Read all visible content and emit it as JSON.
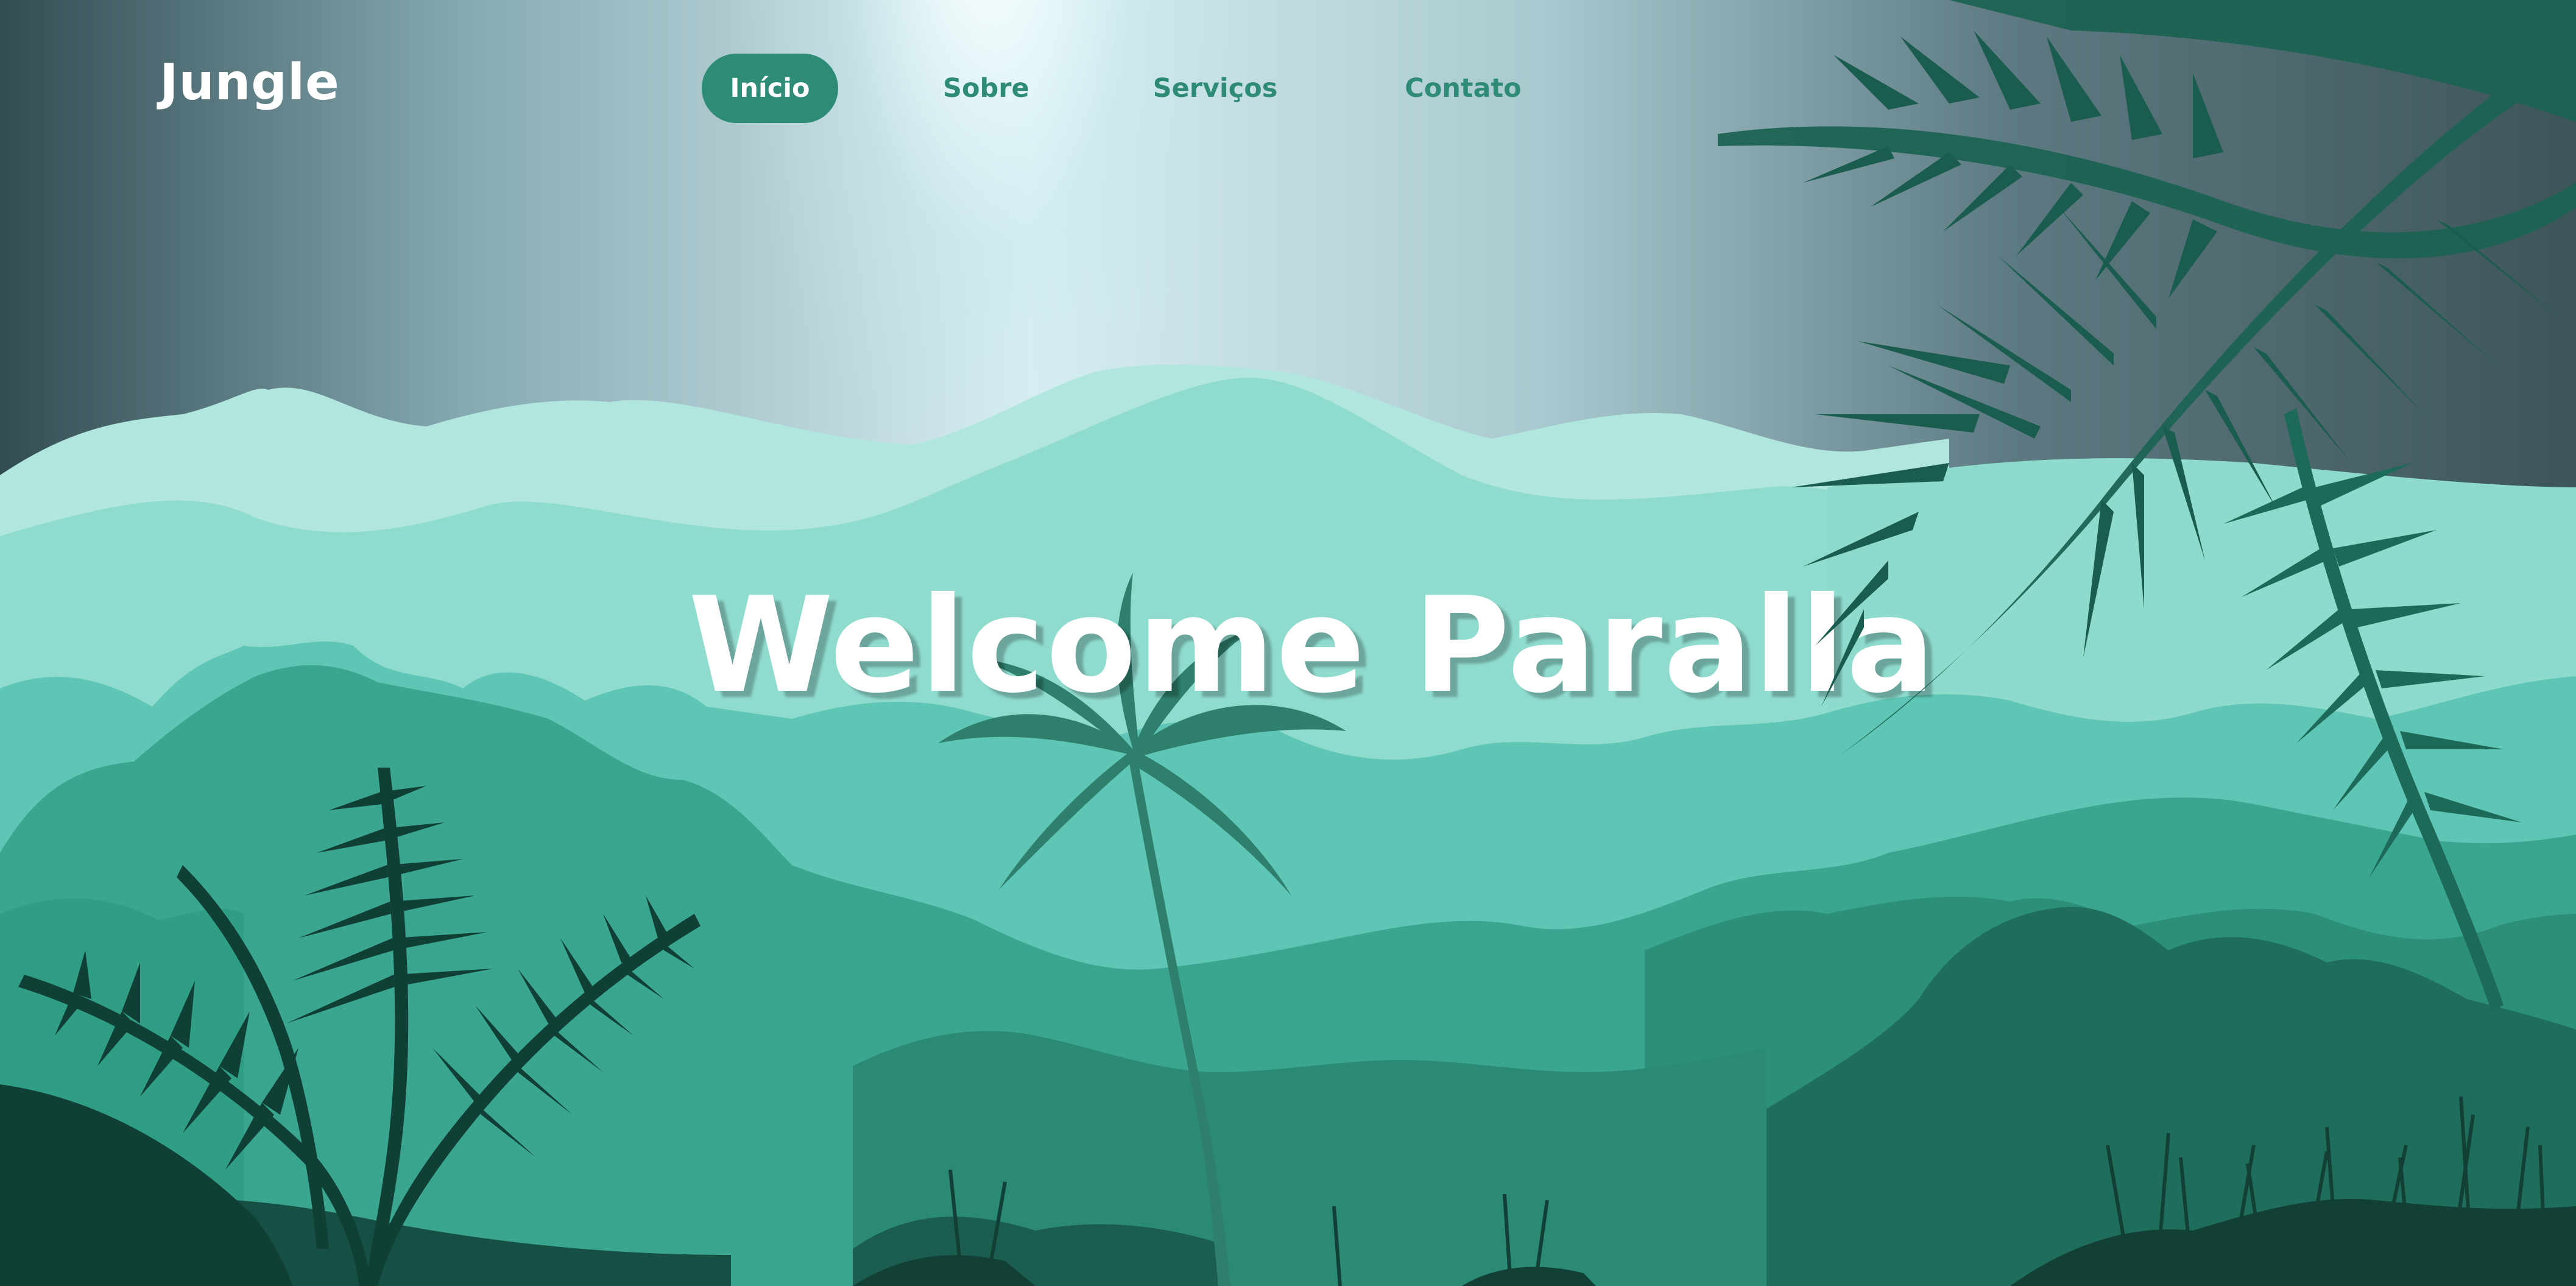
{
  "header": {
    "logo": "Jungle",
    "nav": [
      {
        "label": "Início",
        "active": true
      },
      {
        "label": "Sobre",
        "active": false
      },
      {
        "label": "Serviços",
        "active": false
      },
      {
        "label": "Contato",
        "active": false
      }
    ]
  },
  "hero": {
    "title": "Welcome Paralla"
  },
  "colors": {
    "accent": "#2e8b76",
    "sky_top": "#7fa9b3",
    "mountain_light": "#b1e6de",
    "mountain_mid": "#8fdccf",
    "forest": "#2f9e85",
    "foreground": "#0d3b32"
  }
}
